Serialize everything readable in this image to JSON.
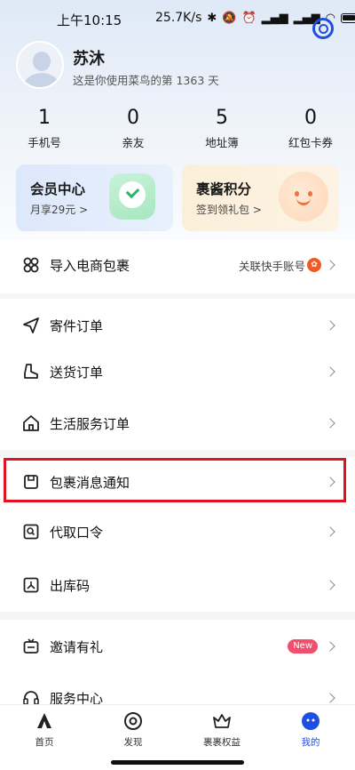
{
  "status_bar": {
    "time": "上午10:15",
    "network_speed": "25.7K/s",
    "icons": [
      "bluetooth-icon",
      "mute-icon",
      "alarm-icon",
      "signal-icon",
      "signal-icon",
      "wifi-icon",
      "battery-icon"
    ]
  },
  "profile": {
    "name": "苏沐",
    "subtitle": "这是你使用菜鸟的第 1363 天"
  },
  "stats": [
    {
      "value": "1",
      "label": "手机号"
    },
    {
      "value": "0",
      "label": "亲友"
    },
    {
      "value": "5",
      "label": "地址簿"
    },
    {
      "value": "0",
      "label": "红包卡券"
    }
  ],
  "cards": {
    "member": {
      "title": "会员中心",
      "sub": "月享29元 >"
    },
    "points": {
      "title": "裹酱积分",
      "sub": "签到领礼包 >"
    }
  },
  "import_row": {
    "label": "导入电商包裹",
    "right_text": "关联快手账号"
  },
  "order_rows": [
    {
      "label": "寄件订单"
    },
    {
      "label": "送货订单"
    },
    {
      "label": "生活服务订单"
    }
  ],
  "notice_rows": [
    {
      "label": "包裹消息通知"
    },
    {
      "label": "代取口令"
    },
    {
      "label": "出库码"
    }
  ],
  "extra_rows": [
    {
      "label": "邀请有礼",
      "badge": "New"
    },
    {
      "label": "服务中心"
    }
  ],
  "bottom_nav": [
    {
      "label": "首页"
    },
    {
      "label": "发现"
    },
    {
      "label": "裹裹权益"
    },
    {
      "label": "我的"
    }
  ],
  "colors": {
    "accent": "#1f4fe0",
    "highlight": "#e0141e",
    "new_badge": "#f0506e"
  }
}
